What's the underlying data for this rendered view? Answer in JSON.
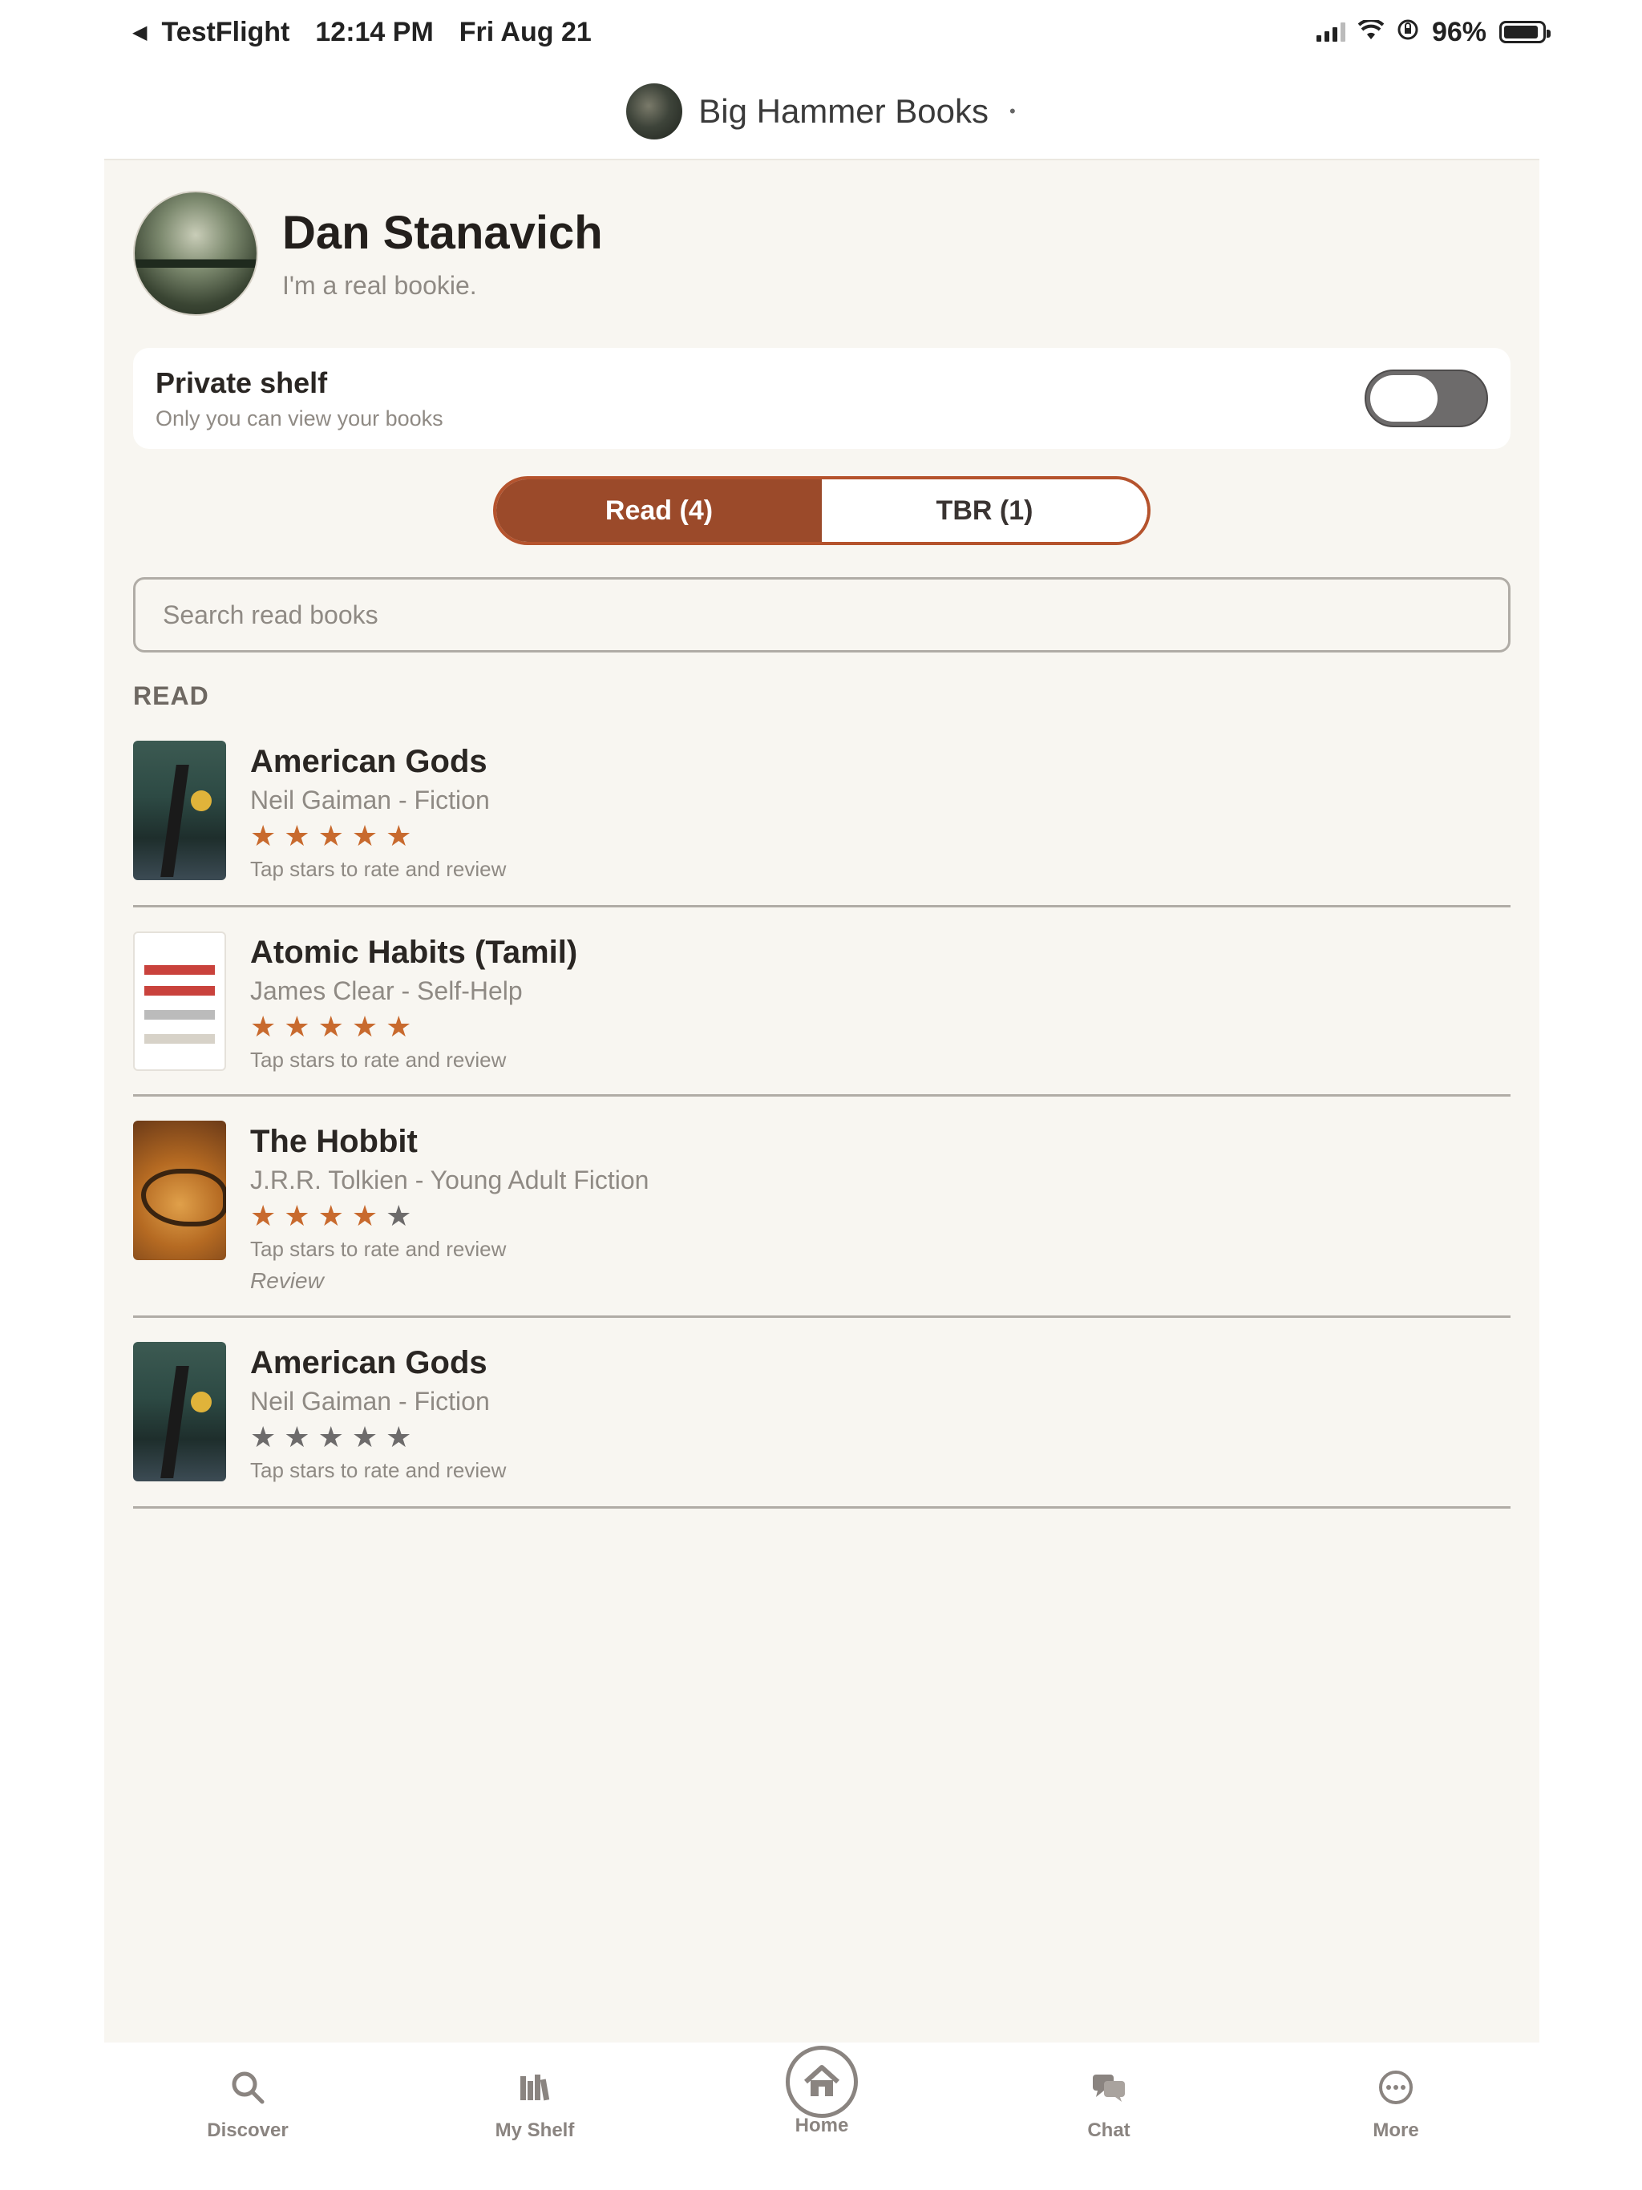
{
  "status_bar": {
    "back_app": "TestFlight",
    "time": "12:14 PM",
    "date": "Fri Aug 21",
    "battery": "96%"
  },
  "header": {
    "club_name": "Big Hammer Books"
  },
  "profile": {
    "name": "Dan Stanavich",
    "bio": "I'm a real bookie."
  },
  "private_shelf": {
    "title": "Private shelf",
    "subtitle": "Only you can view your books",
    "enabled": false
  },
  "tabs": {
    "read_label": "Read (4)",
    "tbr_label": "TBR (1)",
    "selected": "read"
  },
  "search": {
    "placeholder": "Search read books",
    "value": ""
  },
  "section_label": "READ",
  "books": [
    {
      "title": "American Gods",
      "meta": "Neil Gaiman - Fiction",
      "rating": 5,
      "hint": "Tap stars to rate and review",
      "cover": "ag"
    },
    {
      "title": "Atomic Habits (Tamil)",
      "meta": "James Clear - Self-Help",
      "rating": 5,
      "hint": "Tap stars to rate and review",
      "cover": "ah"
    },
    {
      "title": "The Hobbit",
      "meta": "J.R.R. Tolkien - Young Adult Fiction",
      "rating": 4,
      "hint": "Tap stars to rate and review",
      "review": "Review",
      "cover": "hb"
    },
    {
      "title": "American Gods",
      "meta": "Neil Gaiman - Fiction",
      "rating": 0,
      "hint": "Tap stars to rate and review",
      "cover": "ag"
    }
  ],
  "bottom_nav": [
    {
      "label": "Discover",
      "icon": "search-icon"
    },
    {
      "label": "My Shelf",
      "icon": "shelf-icon"
    },
    {
      "label": "Home",
      "icon": "home-icon"
    },
    {
      "label": "Chat",
      "icon": "chat-icon"
    },
    {
      "label": "More",
      "icon": "more-icon"
    }
  ],
  "colors": {
    "accent": "#9b4a2a",
    "star_on": "#c86a2e",
    "background": "#f8f6f1"
  }
}
